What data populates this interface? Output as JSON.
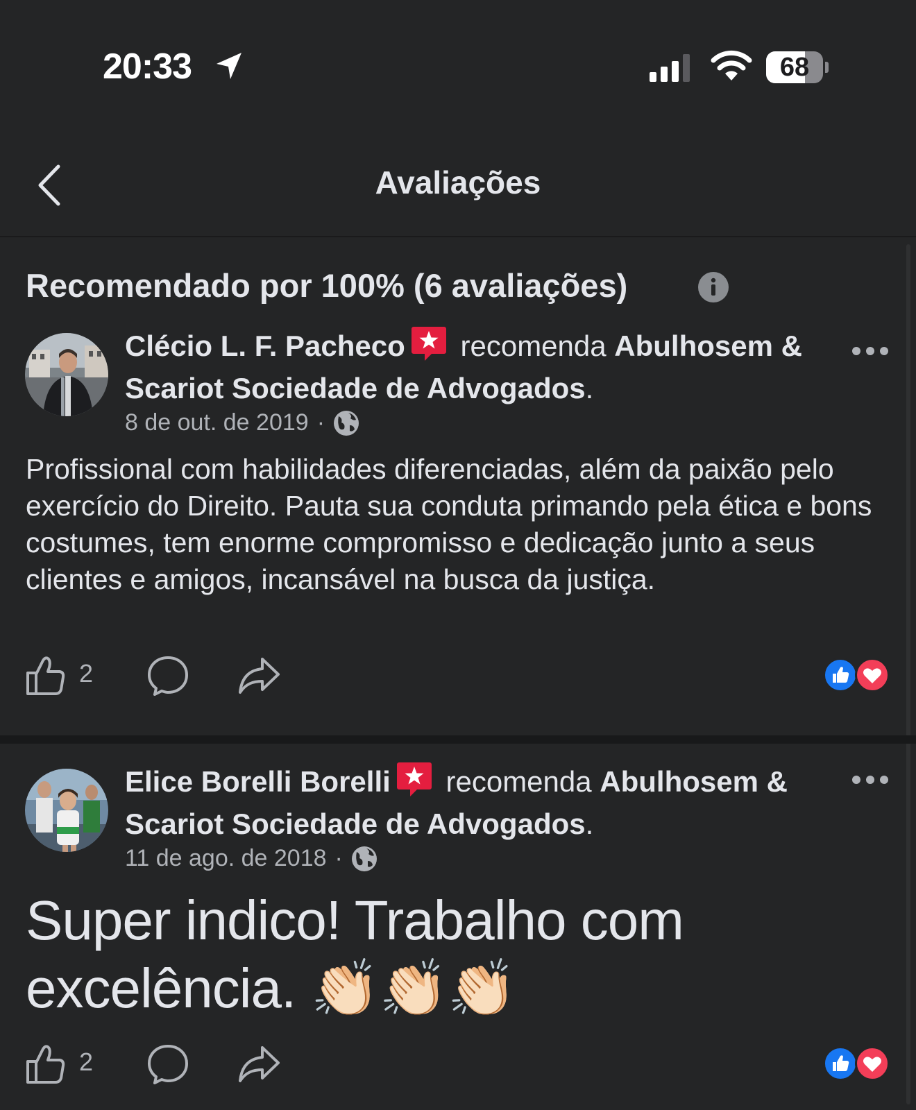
{
  "status_bar": {
    "time": "20:33",
    "battery": "68",
    "battery_level": 0.68,
    "icons": [
      "location-arrow-icon",
      "cellular-signal-icon",
      "wifi-icon",
      "battery-icon"
    ]
  },
  "nav": {
    "title": "Avaliações",
    "back_icon": "chevron-left-icon"
  },
  "summary": {
    "text": "Recomendado por 100% (6 avaliações)",
    "icon": "info-icon"
  },
  "reviews": [
    {
      "author": "Clécio L. F. Pacheco",
      "verb": "recomenda",
      "page": "Abulhosem & Scariot Sociedade de Advogados",
      "punct": ".",
      "date": "8 de out. de 2019",
      "separator": "·",
      "body": "Profissional com habilidades diferenciadas, além da paixão pelo exercício do Direito. Pauta sua conduta primando pela ética e bons costumes, tem enorme compromisso e dedicação junto a seus clientes e amigos, incansável na busca da justiça.",
      "likes": "2"
    },
    {
      "author": "Elice Borelli Borelli",
      "verb": "recomenda",
      "page": "Abulhosem & Scariot Sociedade de Advogados",
      "punct": ".",
      "date": "11 de ago. de 2018",
      "separator": "·",
      "body": "Super indico! Trabalho com excelência. 👏🏻👏🏻👏🏻",
      "likes": "2"
    }
  ],
  "colors": {
    "background": "#242526",
    "text": "#e4e6eb",
    "secondary_text": "#b0b3b8",
    "like_blue": "#1877f2",
    "love_red": "#f33e58",
    "badge_red": "#e41e3f"
  }
}
